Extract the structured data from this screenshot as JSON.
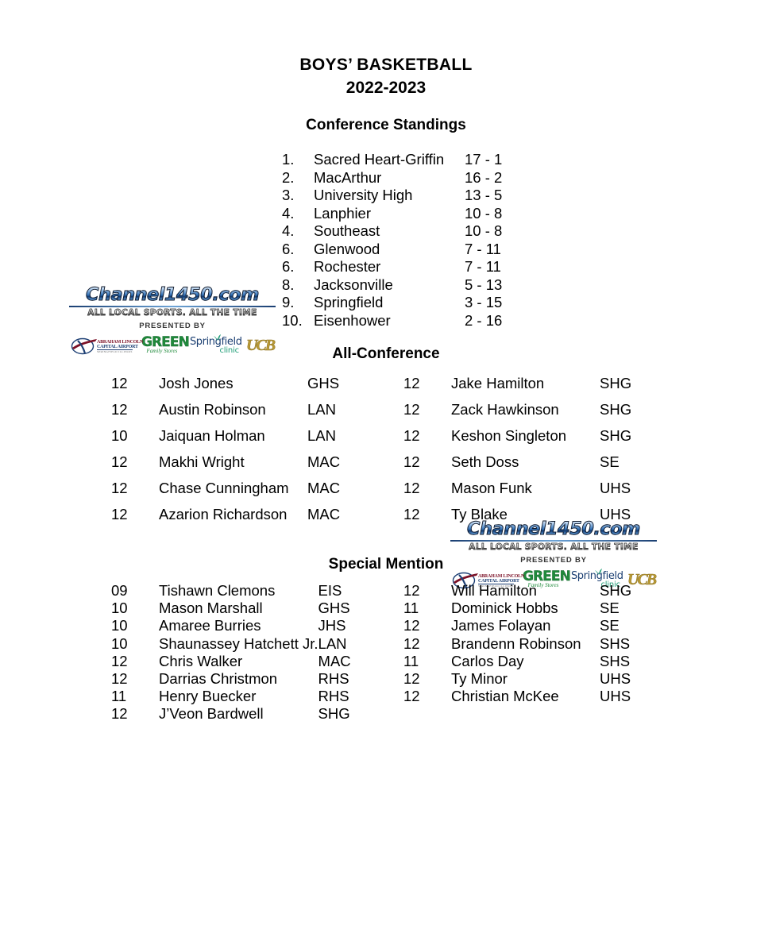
{
  "document": {
    "title": "BOYS’ BASKETBALL",
    "season": "2022-2023"
  },
  "sections": {
    "standings_heading": "Conference Standings",
    "all_conference_heading": "All-Conference",
    "special_mention_heading": "Special Mention"
  },
  "standings": [
    {
      "rank": "1.",
      "team": "Sacred Heart-Griffin",
      "record": "17 - 1"
    },
    {
      "rank": "2.",
      "team": "MacArthur",
      "record": "16 - 2"
    },
    {
      "rank": "3.",
      "team": "University High",
      "record": "13 - 5"
    },
    {
      "rank": "4.",
      "team": "Lanphier",
      "record": "10 - 8"
    },
    {
      "rank": "4.",
      "team": "Southeast",
      "record": "10 - 8"
    },
    {
      "rank": "6.",
      "team": "Glenwood",
      "record": "7 - 11"
    },
    {
      "rank": "6.",
      "team": "Rochester",
      "record": "7 - 11"
    },
    {
      "rank": "8.",
      "team": "Jacksonville",
      "record": "5 - 13"
    },
    {
      "rank": "9.",
      "team": "Springfield",
      "record": "3 - 15"
    },
    {
      "rank": "10.",
      "team": "Eisenhower",
      "record": "2 - 16"
    }
  ],
  "all_conference": {
    "left": [
      {
        "grade": "12",
        "name": "Josh Jones",
        "school": "GHS"
      },
      {
        "grade": "12",
        "name": "Austin Robinson",
        "school": "LAN"
      },
      {
        "grade": "10",
        "name": "Jaiquan Holman",
        "school": "LAN"
      },
      {
        "grade": "12",
        "name": "Makhi Wright",
        "school": "MAC"
      },
      {
        "grade": "12",
        "name": "Chase Cunningham",
        "school": "MAC"
      },
      {
        "grade": "12",
        "name": "Azarion Richardson",
        "school": "MAC"
      }
    ],
    "right": [
      {
        "grade": "12",
        "name": "Jake Hamilton",
        "school": "SHG"
      },
      {
        "grade": "12",
        "name": "Zack Hawkinson",
        "school": "SHG"
      },
      {
        "grade": "12",
        "name": "Keshon Singleton",
        "school": "SHG"
      },
      {
        "grade": "12",
        "name": "Seth Doss",
        "school": "SE"
      },
      {
        "grade": "12",
        "name": "Mason Funk",
        "school": "UHS"
      },
      {
        "grade": "12",
        "name": "Ty Blake",
        "school": "UHS"
      }
    ]
  },
  "special_mention": {
    "left": [
      {
        "grade": "09",
        "name": "Tishawn Clemons",
        "school": "EIS"
      },
      {
        "grade": "10",
        "name": "Mason Marshall",
        "school": "GHS"
      },
      {
        "grade": "10",
        "name": "Amaree Burries",
        "school": "JHS"
      },
      {
        "grade": "10",
        "name": "Shaunassey Hatchett Jr.",
        "school": "LAN"
      },
      {
        "grade": "12",
        "name": "Chris Walker",
        "school": "MAC"
      },
      {
        "grade": "12",
        "name": "Darrias Christmon",
        "school": "RHS"
      },
      {
        "grade": "11",
        "name": "Henry Buecker",
        "school": "RHS"
      },
      {
        "grade": "12",
        "name": "J’Veon Bardwell",
        "school": "SHG"
      }
    ],
    "right": [
      {
        "grade": "12",
        "name": "Will Hamilton",
        "school": "SHG"
      },
      {
        "grade": "11",
        "name": "Dominick Hobbs",
        "school": "SE"
      },
      {
        "grade": "12",
        "name": "James Folayan",
        "school": "SE"
      },
      {
        "grade": "12",
        "name": "Brandenn Robinson",
        "school": "SHS"
      },
      {
        "grade": "11",
        "name": "Carlos Day",
        "school": "SHS"
      },
      {
        "grade": "12",
        "name": "Ty Minor",
        "school": "UHS"
      },
      {
        "grade": "12",
        "name": "Christian McKee",
        "school": "UHS"
      }
    ]
  },
  "logo": {
    "wordmark": "Channel1450.com",
    "tagline": "ALL LOCAL SPORTS. ALL THE TIME",
    "presented_by": "PRESENTED BY",
    "sponsors": {
      "airport_line1": "ABRAHAM LINCOLN",
      "airport_line2": "CAPITAL AIRPORT",
      "airport_line3": "SPRINGFIELD ILLINOIS",
      "green_main": "GREEN",
      "green_sub": "Family Stores",
      "clinic_main": "Springfield",
      "clinic_sub": "clinic",
      "ucb": "UCB"
    },
    "colors": {
      "wordmark_blue": "#2f6fb5",
      "airport_red": "#7b1026",
      "airport_navy": "#1d3f74",
      "green": "#1f8a3b",
      "clinic_navy": "#1b3f72",
      "clinic_teal": "#1f9e77",
      "ucb_gold": "#b99a36"
    }
  }
}
